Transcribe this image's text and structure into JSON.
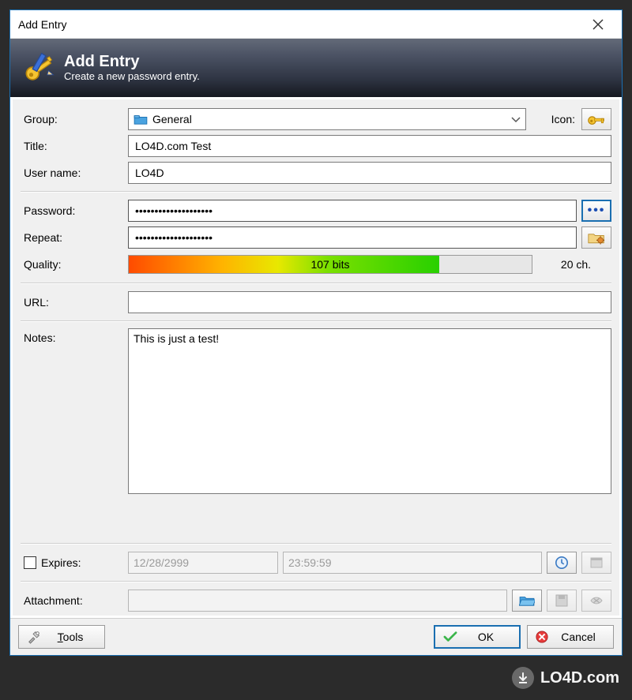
{
  "window": {
    "title": "Add Entry"
  },
  "header": {
    "title": "Add Entry",
    "subtitle": "Create a new password entry."
  },
  "labels": {
    "group": "Group:",
    "icon": "Icon:",
    "title": "Title:",
    "username": "User name:",
    "password": "Password:",
    "repeat": "Repeat:",
    "quality": "Quality:",
    "url": "URL:",
    "notes": "Notes:",
    "expires": "Expires:",
    "attachment": "Attachment:"
  },
  "fields": {
    "group": "General",
    "title": "LO4D.com Test",
    "username": "LO4D",
    "password_mask": "••••••••••••••••••••",
    "repeat_mask": "••••••••••••••••••••",
    "url": "",
    "notes": "This is just a test!",
    "expires_date": "12/28/2999",
    "expires_time": "23:59:59",
    "attachment": ""
  },
  "quality": {
    "bits_text": "107 bits",
    "chars_text": "20 ch.",
    "fill_percent": 77
  },
  "buttons": {
    "tools": "Tools",
    "ok": "OK",
    "cancel": "Cancel"
  },
  "watermark": "LO4D.com"
}
